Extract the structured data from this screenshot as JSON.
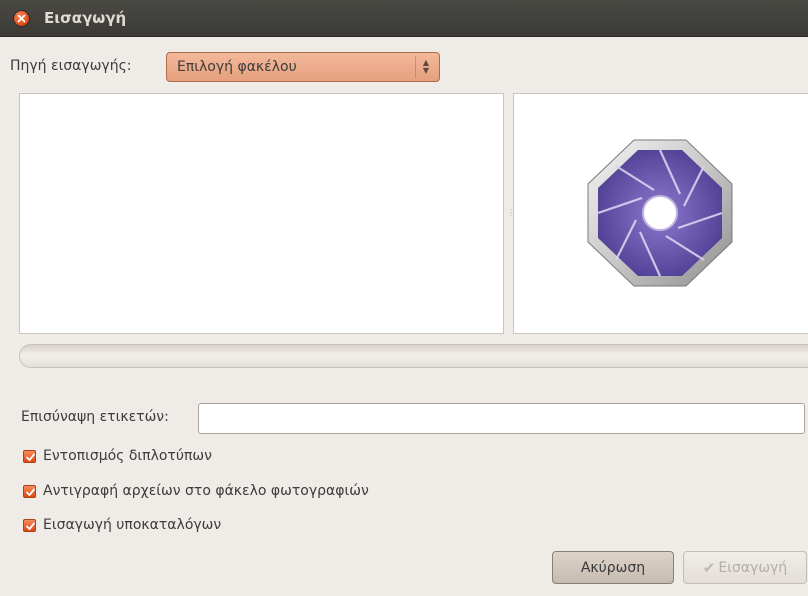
{
  "window": {
    "title": "Εισαγωγή",
    "close_icon": "close-icon"
  },
  "source": {
    "label": "Πηγή εισαγωγής:",
    "selected": "Επιλογή φακέλου"
  },
  "preview": {
    "logo_icon": "shotwell-aperture-icon"
  },
  "tags": {
    "label": "Επισύναψη ετικετών:",
    "value": ""
  },
  "options": [
    {
      "label": "Εντοπισμός διπλοτύπων",
      "checked": true
    },
    {
      "label": "Αντιγραφή αρχείων στο φάκελο φωτογραφιών",
      "checked": true
    },
    {
      "label": "Εισαγωγή υποκαταλόγων",
      "checked": true
    }
  ],
  "buttons": {
    "cancel": "Ακύρωση",
    "import": "Εισαγωγή"
  },
  "colors": {
    "accent": "#dd4814",
    "titlebar": "#3c3b37",
    "combo": "#eaa98a"
  }
}
